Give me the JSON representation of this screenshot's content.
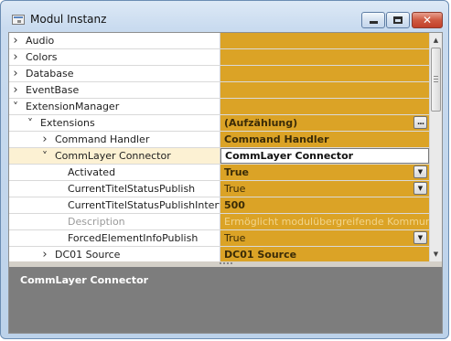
{
  "window": {
    "title": "Modul Instanz",
    "icon": "app-icon",
    "buttons": {
      "minimize": "minimize-icon",
      "maximize": "maximize-icon",
      "close": "✕"
    }
  },
  "colors": {
    "value_bg": "#dba326",
    "highlight_row": "#fcf1d3",
    "description_bg": "#7d7d7d"
  },
  "grid": {
    "rows": [
      {
        "name": "Audio",
        "level": 0,
        "expander": "collapsed",
        "value": "",
        "kind": "category"
      },
      {
        "name": "Colors",
        "level": 0,
        "expander": "collapsed",
        "value": "",
        "kind": "category"
      },
      {
        "name": "Database",
        "level": 0,
        "expander": "collapsed",
        "value": "",
        "kind": "category"
      },
      {
        "name": "EventBase",
        "level": 0,
        "expander": "collapsed",
        "value": "",
        "kind": "category"
      },
      {
        "name": "ExtensionManager",
        "level": 0,
        "expander": "expanded",
        "value": "",
        "kind": "category"
      },
      {
        "name": "Extensions",
        "level": 1,
        "expander": "expanded",
        "value": "(Aufzählung)",
        "kind": "ellipsis",
        "bold": true
      },
      {
        "name": "Command Handler",
        "level": 2,
        "expander": "collapsed",
        "value": "Command Handler",
        "kind": "text",
        "bold": true
      },
      {
        "name": "CommLayer Connector",
        "level": 2,
        "expander": "expanded",
        "value": "CommLayer Connector",
        "kind": "edit",
        "bold": true,
        "highlight": true
      },
      {
        "name": "Activated",
        "level": 3,
        "expander": "",
        "value": "True",
        "kind": "dropdown",
        "bold": true
      },
      {
        "name": "CurrentTitelStatusPublish",
        "level": 3,
        "expander": "",
        "value": "True",
        "kind": "dropdown"
      },
      {
        "name": "CurrentTitelStatusPublishInterval",
        "level": 3,
        "expander": "",
        "value": "500",
        "kind": "text",
        "bold": true
      },
      {
        "name": "Description",
        "level": 3,
        "expander": "",
        "value": "Ermöglicht modulübergreifende Kommunikati",
        "kind": "text",
        "disabled": true
      },
      {
        "name": "ForcedElementInfoPublish",
        "level": 3,
        "expander": "",
        "value": "True",
        "kind": "dropdown"
      },
      {
        "name": "DC01 Source",
        "level": 2,
        "expander": "collapsed",
        "value": "DC01 Source",
        "kind": "text",
        "bold": true
      }
    ]
  },
  "scrollbar": {
    "up": "▲",
    "down": "▼"
  },
  "dropdown_arrow": "▼",
  "ellipsis_label": "...",
  "description": {
    "title": "CommLayer Connector"
  }
}
